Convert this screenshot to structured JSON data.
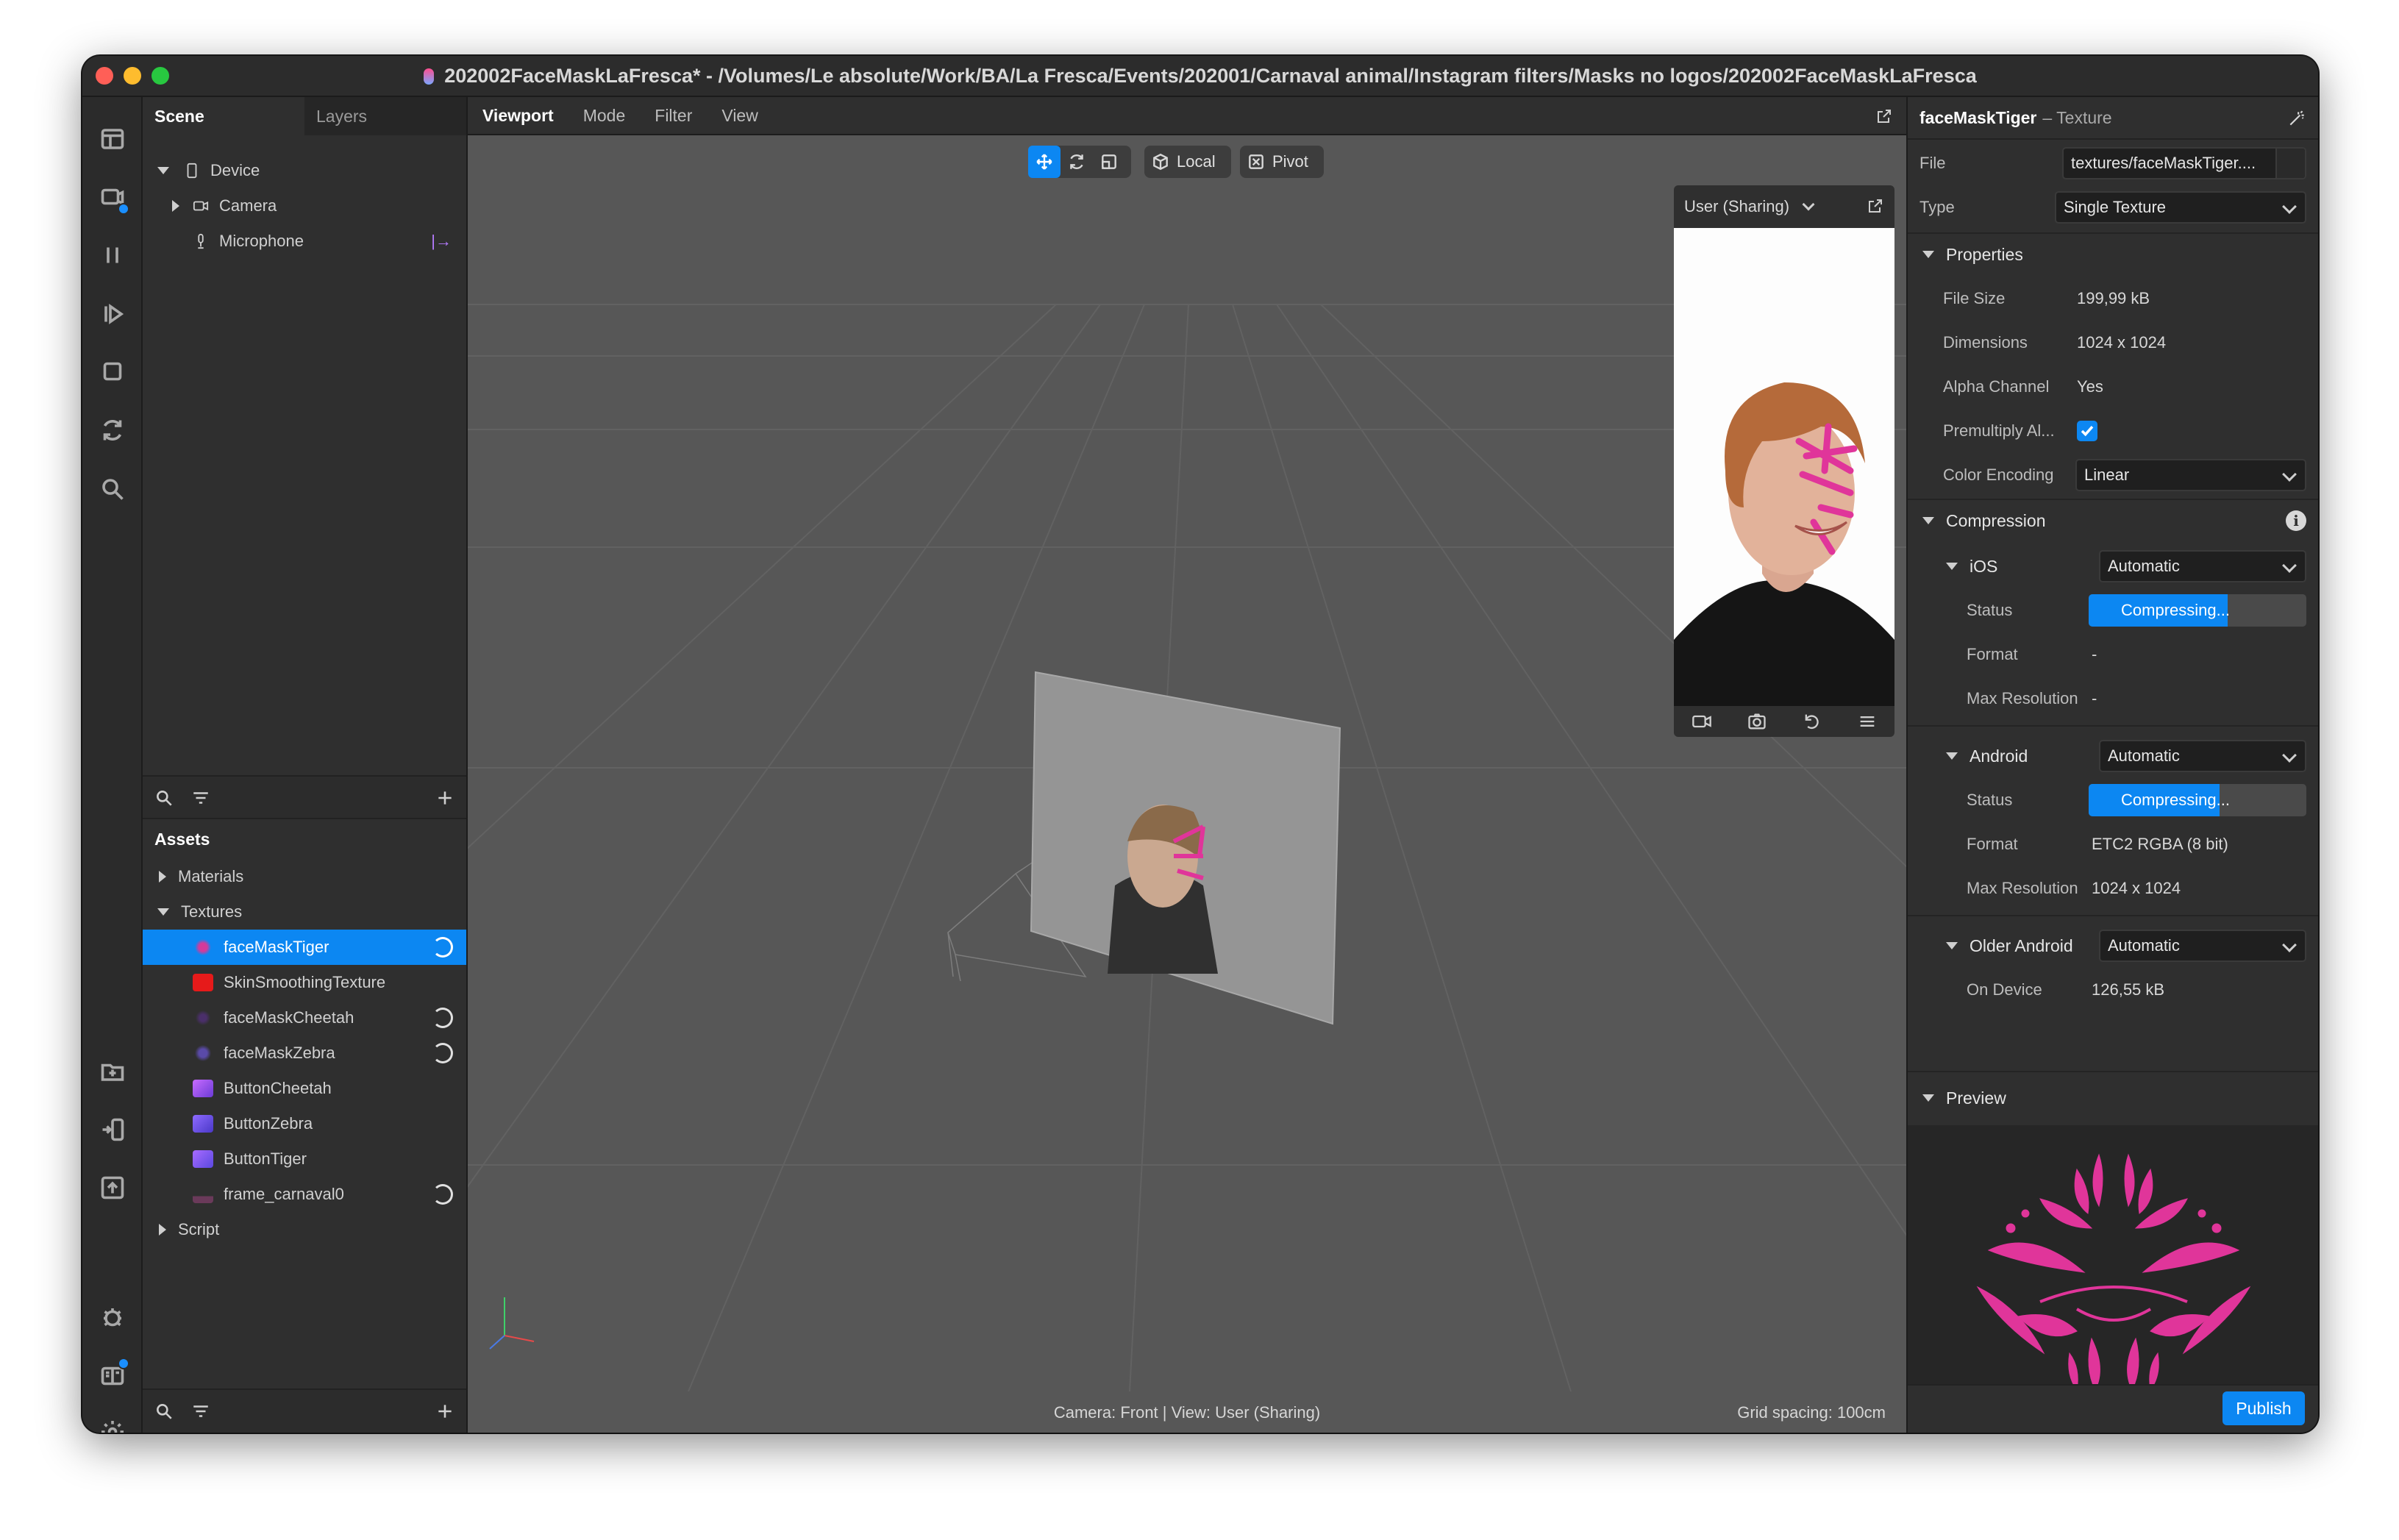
{
  "window": {
    "title": "202002FaceMaskLaFresca* - /Volumes/Le absolute/Work/BA/La Fresca/Events/202001/Carnaval animal/Instagram filters/Masks no logos/202002FaceMaskLaFresca"
  },
  "scene_panel": {
    "tabs": [
      "Scene",
      "Layers"
    ],
    "items": [
      {
        "label": "Device",
        "icon": "device-icon"
      },
      {
        "label": "Camera",
        "icon": "camera-icon"
      },
      {
        "label": "Microphone",
        "icon": "microphone-icon"
      }
    ]
  },
  "assets_panel": {
    "title": "Assets",
    "groups": [
      "Materials",
      "Textures",
      "Script"
    ],
    "textures": [
      {
        "label": "faceMaskTiger",
        "selected": true,
        "loading": true
      },
      {
        "label": "SkinSmoothingTexture",
        "loading": false
      },
      {
        "label": "faceMaskCheetah",
        "loading": true
      },
      {
        "label": "faceMaskZebra",
        "loading": true
      },
      {
        "label": "ButtonCheetah",
        "loading": false
      },
      {
        "label": "ButtonZebra",
        "loading": false
      },
      {
        "label": "ButtonTiger",
        "loading": false
      },
      {
        "label": "frame_carnaval0",
        "loading": true
      }
    ]
  },
  "viewport": {
    "tabs": [
      "Viewport",
      "Mode",
      "Filter",
      "View"
    ],
    "local_label": "Local",
    "pivot_label": "Pivot",
    "preview_user": "User (Sharing)",
    "status_left": "Camera: Front | View: User (Sharing)",
    "status_right": "Grid spacing: 100cm"
  },
  "inspector": {
    "name": "faceMaskTiger",
    "kind": "– Texture",
    "file_label": "File",
    "file_value": "textures/faceMaskTiger....",
    "type_label": "Type",
    "type_value": "Single Texture",
    "properties_title": "Properties",
    "file_size_label": "File Size",
    "file_size_value": "199,99 kB",
    "dimensions_label": "Dimensions",
    "dimensions_value": "1024 x 1024",
    "alpha_label": "Alpha Channel",
    "alpha_value": "Yes",
    "premultiply_label": "Premultiply Al...",
    "premultiply_checked": true,
    "color_encoding_label": "Color Encoding",
    "color_encoding_value": "Linear",
    "compression_title": "Compression",
    "ios_title": "iOS",
    "ios_mode": "Automatic",
    "status_label": "Status",
    "ios_status": "Compressing...",
    "ios_progress": 0.64,
    "format_label": "Format",
    "ios_format": "-",
    "max_res_label": "Max Resolution",
    "ios_max_res": "-",
    "android_title": "Android",
    "android_mode": "Automatic",
    "android_status": "Compressing...",
    "android_progress": 0.6,
    "android_format": "ETC2 RGBA (8 bit)",
    "android_max_res": "1024 x 1024",
    "older_android_title": "Older Android",
    "older_android_mode": "Automatic",
    "on_device_label": "On Device",
    "on_device_value": "126,55 kB",
    "preview_title": "Preview",
    "publish_label": "Publish"
  },
  "colors": {
    "accent": "#0c87f2",
    "mask_pink": "#e0359a"
  }
}
